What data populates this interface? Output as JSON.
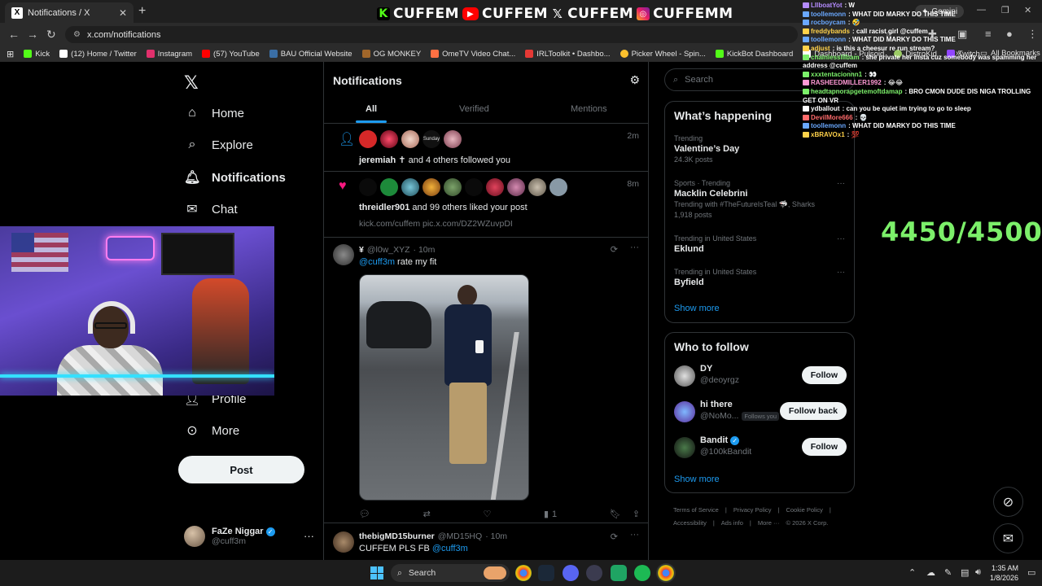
{
  "browser": {
    "tab_title": "Notifications / X",
    "tab_favicon": "X",
    "new_tab_glyph": "+",
    "url": "x.com/notifications",
    "gemini_label": "Gemini",
    "bookmarks": [
      {
        "label": "Kick",
        "color": "#53fc18"
      },
      {
        "label": "(12) Home / Twitter",
        "color": "#ffffff"
      },
      {
        "label": "Instagram",
        "color": "#e1306c"
      },
      {
        "label": "(57) YouTube",
        "color": "#ff0000"
      },
      {
        "label": "BAU Official Website",
        "color": "#3a6ea5"
      },
      {
        "label": "OG MONKEY",
        "color": "#a0662a"
      },
      {
        "label": "OmeTV Video Chat...",
        "color": "#ff7043"
      },
      {
        "label": "IRLToolkit • Dashbo...",
        "color": "#e53935"
      },
      {
        "label": "Picker Wheel - Spin...",
        "color": "#fbc02d"
      },
      {
        "label": "KickBot Dashboard",
        "color": "#53fc18"
      },
      {
        "label": "Dashboard - Pulsoid",
        "color": "#ffffff"
      },
      {
        "label": "DistroKid",
        "color": "#9ccc65"
      },
      {
        "label": "Twitch",
        "color": "#9146ff"
      }
    ],
    "all_bookmarks": "All Bookmarks"
  },
  "stream_banner": {
    "segments": [
      {
        "icon": "kick-icon",
        "text": "CUFFEM"
      },
      {
        "icon": "youtube-icon",
        "text": "CUFFEM"
      },
      {
        "icon": "x-icon",
        "text": "CUFFEM"
      },
      {
        "icon": "instagram-icon",
        "text": "CUFFEMM"
      }
    ]
  },
  "nav": {
    "items": [
      {
        "label": "Home",
        "icon": "home-icon"
      },
      {
        "label": "Explore",
        "icon": "search-icon"
      },
      {
        "label": "Notifications",
        "icon": "bell-icon"
      },
      {
        "label": "Chat",
        "icon": "mail-icon"
      },
      {
        "label": "Profile",
        "icon": "person-icon"
      },
      {
        "label": "More",
        "icon": "more-icon"
      }
    ],
    "post_button": "Post",
    "profile": {
      "name": "FaZe Niggar",
      "handle": "@cuff3m"
    }
  },
  "notifications": {
    "title": "Notifications",
    "tabs": [
      "All",
      "Verified",
      "Mentions"
    ],
    "items": [
      {
        "type": "follow",
        "time": "2m",
        "bold": "jeremiah ✝",
        "text": " and 4 others followed you",
        "avatar_label": "Sunday"
      },
      {
        "type": "like",
        "time": "8m",
        "bold": "threidler901",
        "text": " and 99 others liked your post",
        "link": "kick.com/cuffem pic.x.com/DZ2WZuvpDI"
      }
    ],
    "tweets": [
      {
        "name": "¥",
        "handle": "@l0w_XYZ",
        "time": "· 10m",
        "mention": "@cuff3m",
        "text": " rate my fit",
        "views": "1"
      },
      {
        "name": "thebigMD15burner",
        "handle": "@MD15HQ",
        "time": "· 10m",
        "text": "CUFFEM PLS FB ",
        "mention": "@cuff3m"
      }
    ]
  },
  "right": {
    "search_placeholder": "Search",
    "happening_title": "What’s happening",
    "trends": [
      {
        "label": "Trending",
        "title": "Valentine’s Day",
        "count": "24.3K posts"
      },
      {
        "label": "Sports · Trending",
        "title": "Macklin Celebrini",
        "extra": "Trending with #TheFutureIsTeal 🦈, Sharks",
        "count": "1,918 posts"
      },
      {
        "label": "Trending in United States",
        "title": "Eklund"
      },
      {
        "label": "Trending in United States",
        "title": "Byfield"
      }
    ],
    "show_more": "Show more",
    "who_title": "Who to follow",
    "who": [
      {
        "name": "DY",
        "handle": "@deoyrgz",
        "button": "Follow"
      },
      {
        "name": "hi there",
        "handle": "@NoMo...",
        "badge": "Follows you",
        "button": "Follow back"
      },
      {
        "name": "Bandit",
        "handle": "@100kBandit",
        "button": "Follow",
        "verified": true
      }
    ],
    "footer": [
      "Terms of Service",
      "|",
      "Privacy Policy",
      "|",
      "Cookie Policy",
      "|",
      "Accessibility",
      "|",
      "Ads info",
      "|",
      "More ···",
      "© 2026 X Corp."
    ]
  },
  "chat": [
    {
      "user": "LIlboatYot",
      "color": "#b58cff",
      "text": "W"
    },
    {
      "user": "toollemonn",
      "color": "#6aa8ff",
      "text": "WHAT DID MARKY DO THIS TIME"
    },
    {
      "user": "rocboycam",
      "color": "#6aa8ff",
      "text": "🤣"
    },
    {
      "user": "freddybands",
      "color": "#ffd24a",
      "text": "call racist girl @cuffem"
    },
    {
      "user": "toollemonn",
      "color": "#6aa8ff",
      "text": "WHAT DID MARKY DO THIS TIME"
    },
    {
      "user": "adjust",
      "color": "#ffd24a",
      "text": "is this a cheesur re run stream?"
    },
    {
      "user": "chainlesslilbam",
      "color": "#7cf06a",
      "text": "she private her insta cuz somebody was spamming her address @cuffem"
    },
    {
      "user": "xxxtentacionnn1",
      "color": "#7cf06a",
      "text": "👀"
    },
    {
      "user": "RASHEEDMILLER1992",
      "color": "#ff9ad5",
      "text": "😂😂"
    },
    {
      "user": "headtapnorapgetemoftdamap",
      "color": "#7cf06a",
      "text": "BRO CMON DUDE DIS NIGA TROLLING GET ON VR"
    },
    {
      "user": "ydballout",
      "color": "#ffffff",
      "text": "can you be quiet im trying to go to sleep"
    },
    {
      "user": "DevilMore666",
      "color": "#ff6b6b",
      "text": "💀"
    },
    {
      "user": "toollemonn",
      "color": "#6aa8ff",
      "text": "WHAT DID MARKY DO THIS TIME"
    },
    {
      "user": "xBRAVOx1",
      "color": "#ffd24a",
      "text": "💯"
    }
  ],
  "goal_counter": "4450/4500",
  "taskbar": {
    "search_label": "Search",
    "time": "1:35 AM",
    "date": "1/8/2026"
  }
}
